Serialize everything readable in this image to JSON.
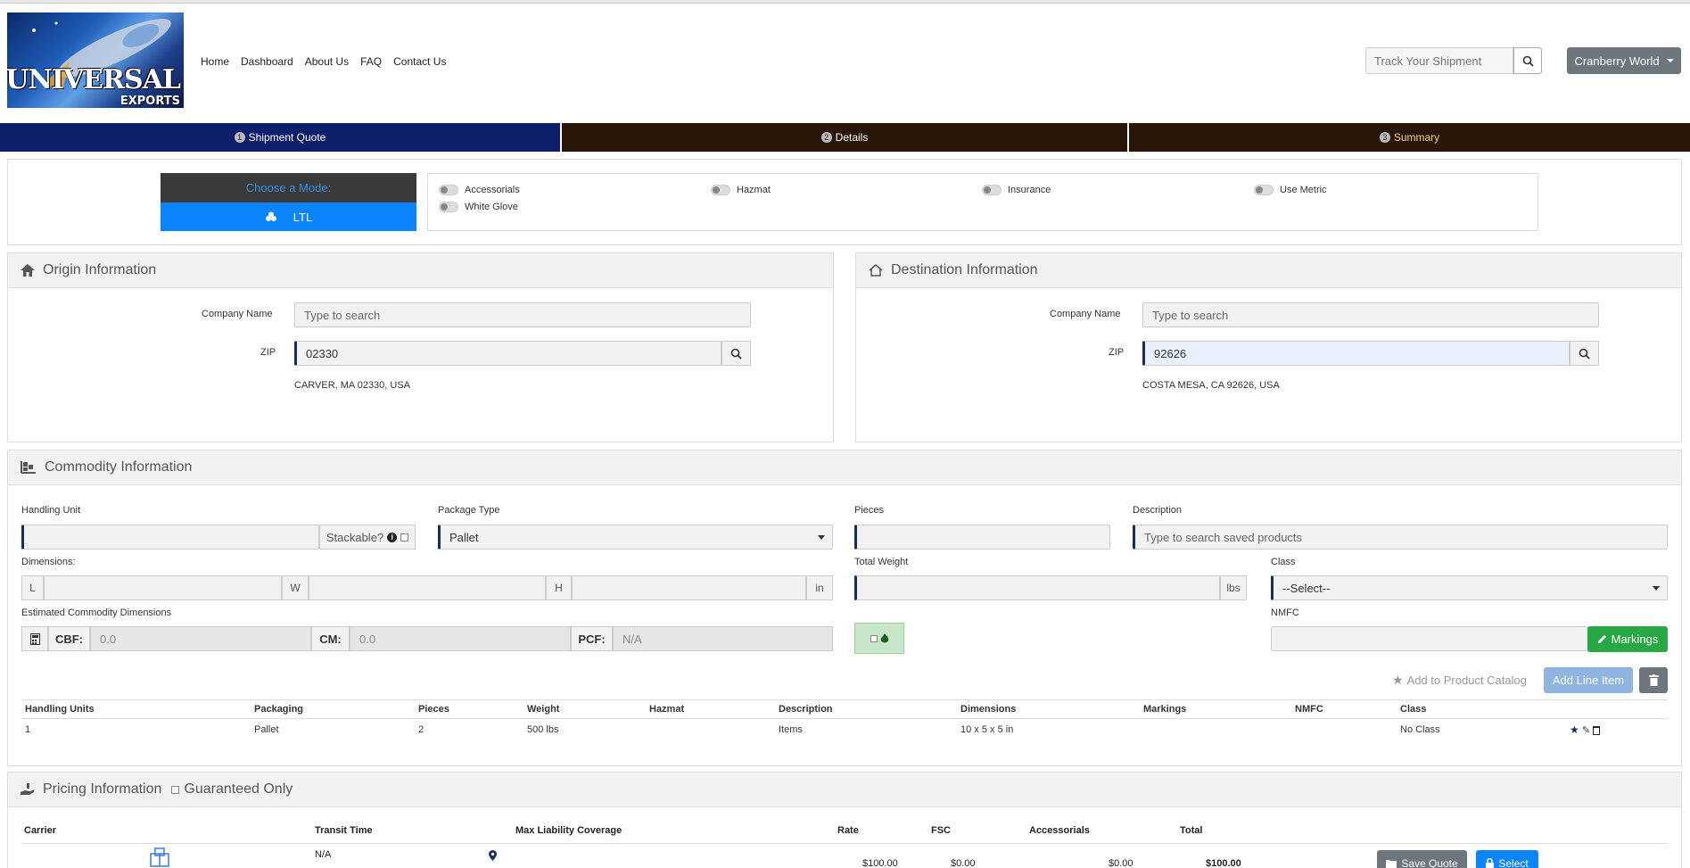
{
  "brand": {
    "line1": "UNIVERSAL",
    "line2": "EXPORTS"
  },
  "nav": [
    "Home",
    "Dashboard",
    "About Us",
    "FAQ",
    "Contact Us"
  ],
  "track": {
    "placeholder": "Track Your Shipment"
  },
  "user": {
    "name": "Cranberry World"
  },
  "steps": [
    {
      "num": "1",
      "label": "Shipment Quote"
    },
    {
      "num": "2",
      "label": "Details"
    },
    {
      "num": "3",
      "label": "Summary"
    }
  ],
  "mode": {
    "heading": "Choose a Mode:",
    "selected": "LTL"
  },
  "options": [
    "Accessorials",
    "Hazmat",
    "Insurance",
    "Use Metric",
    "White Glove"
  ],
  "origin": {
    "title": "Origin Information",
    "company_label": "Company Name",
    "company_placeholder": "Type to search",
    "zip_label": "ZIP",
    "zip": "02330",
    "address": "CARVER, MA 02330, USA"
  },
  "destination": {
    "title": "Destination Information",
    "company_label": "Company Name",
    "company_placeholder": "Type to search",
    "zip_label": "ZIP",
    "zip": "92626",
    "address": "COSTA MESA, CA 92626, USA"
  },
  "commodity": {
    "title": "Commodity Information",
    "handling_unit_label": "Handling Unit",
    "stackable_label": "Stackable?",
    "package_type_label": "Package Type",
    "package_type": "Pallet",
    "pieces_label": "Pieces",
    "description_label": "Description",
    "description_placeholder": "Type to search saved products",
    "dimensions_label": "Dimensions:",
    "dim_l": "L",
    "dim_w": "W",
    "dim_h": "H",
    "dim_unit": "in",
    "total_weight_label": "Total Weight",
    "weight_unit": "lbs",
    "class_label": "Class",
    "class_value": "--Select--",
    "est_label": "Estimated Commodity Dimensions",
    "cbf_label": "CBF:",
    "cbf_value": "0.0",
    "cm_label": "CM:",
    "cm_value": "0.0",
    "pcf_label": "PCF:",
    "pcf_value": "N/A",
    "nmfc_label": "NMFC",
    "markings_btn": "Markings",
    "add_catalog": "Add to Product Catalog",
    "add_line": "Add Line Item",
    "columns": [
      "Handling Units",
      "Packaging",
      "Pieces",
      "Weight",
      "Hazmat",
      "Description",
      "Dimensions",
      "Markings",
      "NMFC",
      "Class"
    ],
    "rows": [
      {
        "handling_units": "1",
        "packaging": "Pallet",
        "pieces": "2",
        "weight": "500 lbs",
        "hazmat": "",
        "description": "Items",
        "dimensions": "10 x 5 x 5 in",
        "markings": "",
        "nmfc": "",
        "class": "No Class"
      }
    ]
  },
  "pricing": {
    "title": "Pricing Information",
    "guaranteed_label": "Guaranteed Only",
    "columns": [
      "Carrier",
      "Transit Time",
      "Max Liability Coverage",
      "Rate",
      "FSC",
      "Accessorials",
      "Total"
    ],
    "row": {
      "transit": "N/A",
      "rate": "$100.00",
      "fsc": "$0.00",
      "accessorials": "$0.00",
      "total": "$100.00"
    },
    "save_btn": "Save Quote",
    "select_btn": "Select"
  },
  "colors": {
    "step_active": "#0d1f6b",
    "step_inactive": "#2a1608",
    "mode_blue": "#0a84ff",
    "success": "#28a745",
    "info": "#8fb4df"
  }
}
